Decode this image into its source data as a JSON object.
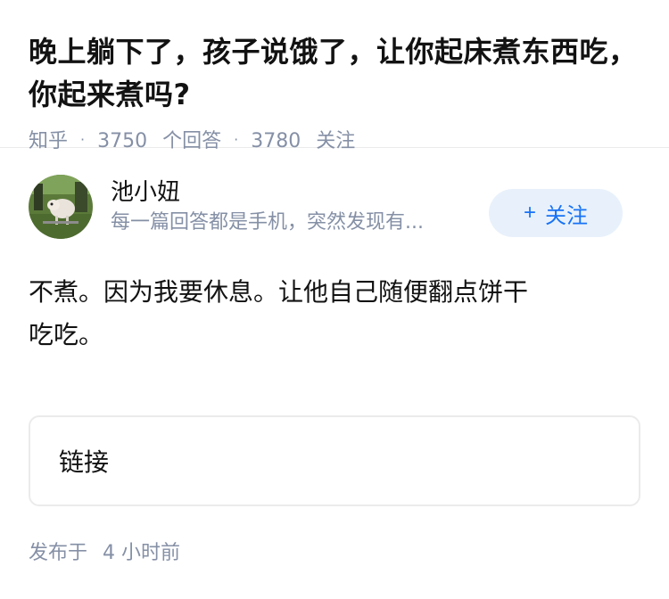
{
  "question": {
    "title": "晚上躺下了，孩子说饿了，让你起床煮东西吃，你起来煮吗?",
    "source": "知乎",
    "answers_count": "3750",
    "answers_label": "个回答",
    "followers_count": "3780",
    "followers_label": "关注"
  },
  "author": {
    "name": "池小妞",
    "bio": "每一篇回答都是手机，突然发现有...",
    "follow_plus": "+",
    "follow_label": "关注"
  },
  "answer": {
    "content": "不煮。因为我要休息。让他自己随便翻点饼干吃吃。",
    "link_label": "链接"
  },
  "meta": {
    "published_prefix": "发布于",
    "published_time": "4 小时前"
  },
  "colors": {
    "accent": "#1772f6",
    "accent_bg": "#e8f1fb",
    "muted": "#8590a6",
    "text": "#121212",
    "divider": "#ebebeb"
  }
}
